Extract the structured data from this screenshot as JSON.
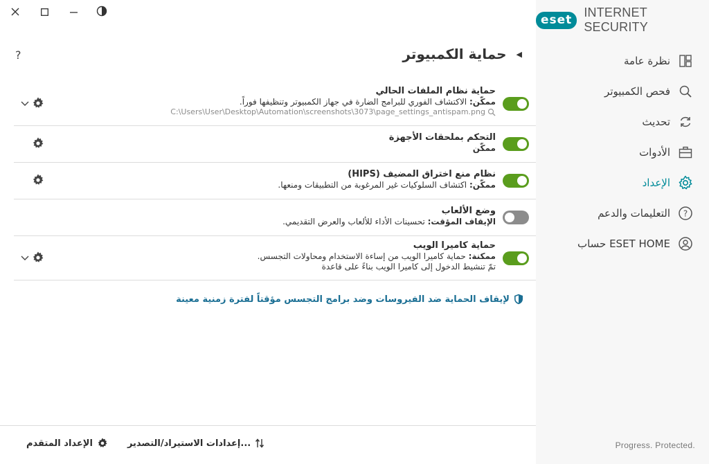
{
  "window": {
    "controls": [
      "close",
      "maximize",
      "minimize",
      "theme"
    ]
  },
  "brand": {
    "logo_text": "eset",
    "product": "INTERNET SECURITY"
  },
  "sidebar": {
    "items": [
      {
        "label": "نظرة عامة",
        "icon": "dashboard-icon"
      },
      {
        "label": "فحص الكمبيوتر",
        "icon": "search-icon"
      },
      {
        "label": "تحديث",
        "icon": "refresh-icon"
      },
      {
        "label": "الأدوات",
        "icon": "briefcase-icon"
      },
      {
        "label": "الإعداد",
        "icon": "gear-icon",
        "active": true
      },
      {
        "label": "التعليمات والدعم",
        "icon": "help-circle-icon"
      },
      {
        "label": "حساب ESET HOME",
        "icon": "user-circle-icon"
      }
    ],
    "tagline": "Progress. Protected."
  },
  "main": {
    "help": "?",
    "title": "حماية الكمبيوتر",
    "rows": [
      {
        "name": "حماية نظام الملفات الحالي",
        "status": "ممكّن:",
        "desc": " الاكتشاف الفوري للبرامج الضارة في جهاز الكمبيوتر وتنظيفها فوراً.",
        "path": "C:\\Users\\User\\Desktop\\Automation\\screenshots\\3073\\page_settings_antispam.png",
        "enabled": true
      },
      {
        "name": "التحكم بملحقات الأجهزة",
        "status": "ممكّن",
        "desc": "",
        "enabled": true
      },
      {
        "name": "نظام منع اختراق المضيف (HIPS)",
        "status": "ممكّن:",
        "desc": " اكتشاف السلوكيات غير المرغوبة من التطبيقات ومنعها.",
        "enabled": true
      },
      {
        "name": "وضع الألعاب",
        "status": "الإيقاف المؤقت:",
        "desc": " تحسينات الأداء للألعاب والعرض التقديمي.",
        "enabled": false
      },
      {
        "name": "حماية كاميرا الويب",
        "status": "ممكنة:",
        "desc": " حماية كاميرا الويب من إساءة الاستخدام ومحاولات التجسس.",
        "desc2": "تمّ تنشيط الدخول إلى كاميرا الويب بناءً على قاعدة",
        "enabled": true
      }
    ],
    "pause_link": "لإيقاف الحماية ضد الفيروسات وضد برامج التجسس مؤقتاً لفترة زمنية معينة"
  },
  "footer": {
    "advanced": "الإعداد المتقدم",
    "import_export": "إعدادات الاستيراد/التصدير..."
  },
  "colors": {
    "accent": "#008b99",
    "toggle_on": "#5a9d1d",
    "toggle_off": "#8c8c8c",
    "link": "#1b6f94"
  }
}
